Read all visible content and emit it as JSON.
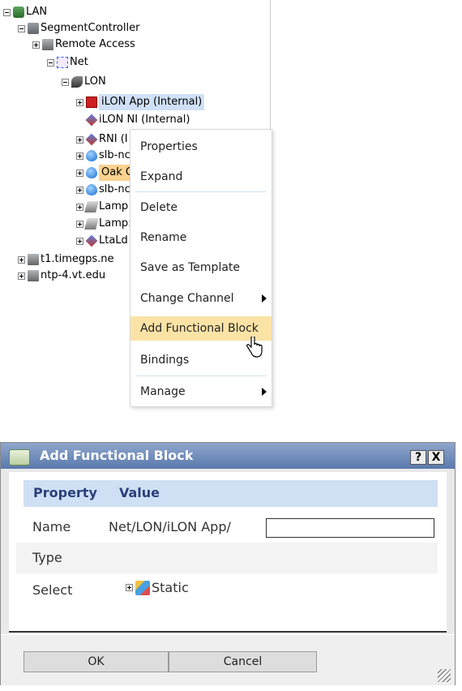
{
  "tree": {
    "nodes": [
      {
        "label": "LAN"
      },
      {
        "label": "SegmentController"
      },
      {
        "label": "Remote Access"
      },
      {
        "label": "Net"
      },
      {
        "label": "LON"
      },
      {
        "label": "iLON App (Internal)"
      },
      {
        "label": "iLON NI (Internal)"
      },
      {
        "label": "RNI (I"
      },
      {
        "label": "slb-nc"
      },
      {
        "label": "Oak C"
      },
      {
        "label": "slb-nc"
      },
      {
        "label": "Lamp"
      },
      {
        "label": "Lamp:"
      },
      {
        "label": "LtaLd"
      },
      {
        "label": "t1.timegps.ne"
      },
      {
        "label": "ntp-4.vt.edu"
      }
    ]
  },
  "context_menu": {
    "items": [
      {
        "label": "Properties"
      },
      {
        "label": "Expand"
      },
      {
        "label": "Delete"
      },
      {
        "label": "Rename"
      },
      {
        "label": "Save as Template"
      },
      {
        "label": "Change Channel"
      },
      {
        "label": "Add Functional Block"
      },
      {
        "label": "Bindings"
      },
      {
        "label": "Manage"
      }
    ],
    "highlight_color": "#fbe3a6"
  },
  "dialog": {
    "title": "Add Functional Block",
    "help_label": "?",
    "close_label": "X",
    "headers": {
      "property": "Property",
      "value": "Value"
    },
    "rows": [
      {
        "key": "Name",
        "value": "Net/LON/iLON App/"
      },
      {
        "key": "Type",
        "value": ""
      },
      {
        "key": "Select",
        "value": ""
      }
    ],
    "name_input_value": "",
    "select_tree_item": "Static",
    "ok_label": "OK",
    "cancel_label": "Cancel"
  },
  "colors": {
    "titlebar": "#6f8cbc",
    "header_bg": "#cfe0f5",
    "header_text": "#2b3f7a"
  }
}
